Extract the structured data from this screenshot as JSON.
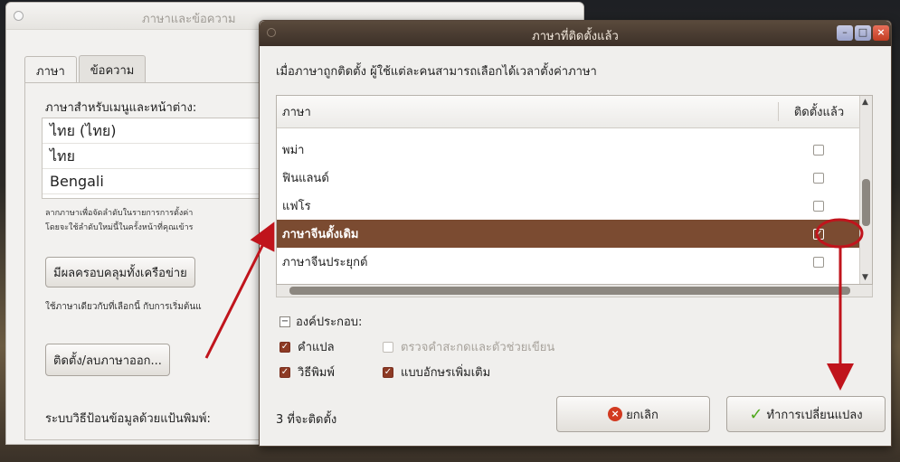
{
  "background_window": {
    "title": "ภาษาและข้อความ",
    "tabs": [
      {
        "label": "ภาษา",
        "active": true
      },
      {
        "label": "ข้อความ",
        "active": false
      }
    ],
    "menu_language_label": "ภาษาสำหรับเมนูและหน้าต่าง:",
    "languages": [
      "ไทย (ไทย)",
      "ไทย",
      "Bengali"
    ],
    "hint_line1": "ลากภาษาเพื่อจัดลำดับในรายการการตั้งค่า",
    "hint_line2": "โดยจะใช้ลำดับใหม่นี้ในครั้งหน้าที่คุณเข้าร",
    "apply_system_button": "มีผลครอบคลุมทั้งเครือข่าย",
    "same_language_hint": "ใช้ภาษาเดียวกับที่เลือกนี้ กับการเริ่มต้นแ",
    "install_remove_button": "ติดตั้ง/ลบภาษาออก...",
    "keyboard_input_label": "ระบบวิธีป้อนข้อมูลด้วยแป้นพิมพ์:"
  },
  "dialog": {
    "title": "ภาษาที่ติดตั้งแล้ว",
    "intro": "เมื่อภาษาถูกติดตั้ง ผู้ใช้แต่ละคนสามารถเลือกได้เวลาตั้งค่าภาษา",
    "col_language": "ภาษา",
    "col_installed": "ติดตั้งแล้ว",
    "rows": [
      {
        "name": "พม่า",
        "installed": false,
        "selected": false
      },
      {
        "name": "ฟินแลนด์",
        "installed": false,
        "selected": false
      },
      {
        "name": "แฟโร",
        "installed": false,
        "selected": false
      },
      {
        "name": "ภาษาจีนดั้งเดิม",
        "installed": true,
        "selected": true
      },
      {
        "name": "ภาษาจีนประยุกต์",
        "installed": false,
        "selected": false
      }
    ],
    "components_label": "องค์ประกอบ:",
    "options": {
      "translation": {
        "label": "คำแปล",
        "checked": true
      },
      "spellcheck": {
        "label": "ตรวจคำสะกดและตัวช่วยเขียน",
        "checked": false
      },
      "input_method": {
        "label": "วิธีพิมพ์",
        "checked": true
      },
      "extra_fonts": {
        "label": "แบบอักษรเพิ่มเติม",
        "checked": true
      }
    },
    "status": "3 ที่จะติดตั้ง",
    "cancel_button": "ยกเลิก",
    "apply_button": "ทำการเปลี่ยนแปลง"
  },
  "colors": {
    "selection": "#7b4b31",
    "annotation": "#c0141c",
    "title_bar": "#4a3c30"
  }
}
